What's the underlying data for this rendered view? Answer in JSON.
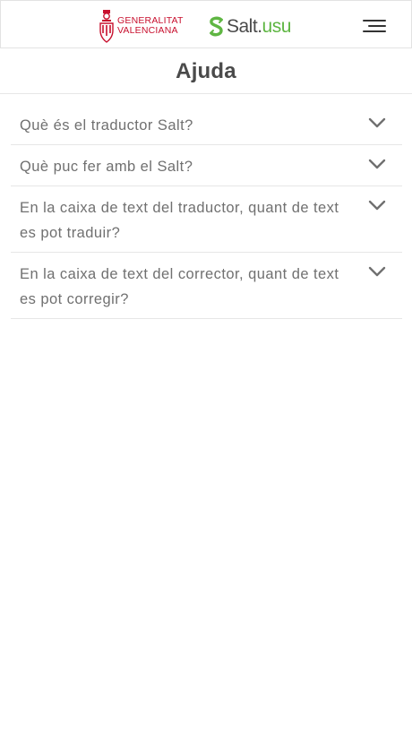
{
  "header": {
    "gva_logo_line1": "GENERALITAT",
    "gva_logo_line2": "VALENCIANA",
    "salt_logo_main": "Salt",
    "salt_logo_dot": ".",
    "salt_logo_suffix": "usu",
    "menu_icon": "hamburger-menu-icon"
  },
  "page": {
    "title": "Ajuda"
  },
  "faq": [
    {
      "question": "Què és el traductor Salt?",
      "icon": "chevron-down-icon"
    },
    {
      "question": "Què puc fer amb el Salt?",
      "icon": "chevron-down-icon"
    },
    {
      "question": "En la caixa de text del traductor, quant de text es pot traduir?",
      "icon": "chevron-down-icon"
    },
    {
      "question": "En la caixa de text del corrector, quant de text es pot corregir?",
      "icon": "chevron-down-icon"
    }
  ],
  "colors": {
    "gva_red": "#c8102e",
    "salt_green": "#5fb643",
    "text_gray": "#707070",
    "title_gray": "#4a4a4a",
    "divider": "#e6e6e6"
  }
}
